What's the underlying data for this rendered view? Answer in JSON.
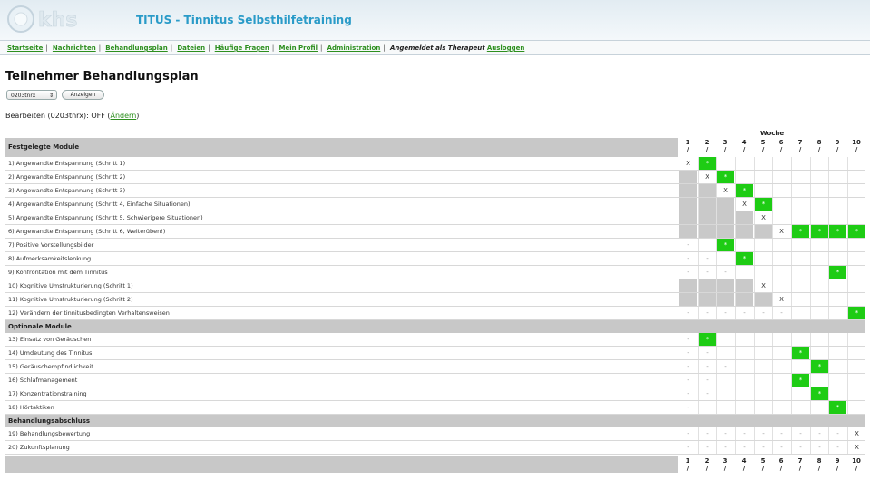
{
  "header": {
    "logo_text": "khs",
    "title": "TITUS - Tinnitus Selbsthilfetraining"
  },
  "nav": {
    "items": [
      "Startseite",
      "Nachrichten",
      "Behandlungsplan",
      "Dateien",
      "Häufige Fragen",
      "Mein Profil",
      "Administration"
    ],
    "logged_in": "Angemeldet als Therapeut",
    "logout": "Ausloggen"
  },
  "page": {
    "title": "Teilnehmer Behandlungsplan",
    "participant_select": "0203tnrx",
    "show_button": "Anzeigen",
    "edit_prefix": "Bearbeiten (0203tnrx): OFF (",
    "edit_link": "Ändern",
    "edit_suffix": ")"
  },
  "colors": {
    "active": "#1ecc14",
    "gray": "#c9c9c9",
    "link": "#2d8f1f",
    "title": "#2a9bc8"
  },
  "plan": {
    "woche_label": "Woche",
    "weeks": [
      "1",
      "2",
      "3",
      "4",
      "5",
      "6",
      "7",
      "8",
      "9",
      "10"
    ],
    "week_marker": "/",
    "sections": [
      {
        "title": "Festgelegte Module",
        "rows": [
          {
            "label": "1) Angewandte Entspannung (Schritt 1)",
            "cells": [
              "X",
              "A",
              "",
              "",
              "",
              "",
              "",
              "",
              "",
              ""
            ]
          },
          {
            "label": "2) Angewandte Entspannung (Schritt 2)",
            "cells": [
              "G",
              "X",
              "A",
              "",
              "",
              "",
              "",
              "",
              "",
              ""
            ]
          },
          {
            "label": "3) Angewandte Entspannung (Schritt 3)",
            "cells": [
              "G",
              "G",
              "X",
              "A",
              "",
              "",
              "",
              "",
              "",
              ""
            ]
          },
          {
            "label": "4) Angewandte Entspannung (Schritt 4, Einfache Situationen)",
            "cells": [
              "G",
              "G",
              "G",
              "X",
              "A",
              "",
              "",
              "",
              "",
              ""
            ]
          },
          {
            "label": "5) Angewandte Entspannung (Schritt 5, Schwierigere Situationen)",
            "cells": [
              "G",
              "G",
              "G",
              "G",
              "X",
              "",
              "",
              "",
              "",
              ""
            ]
          },
          {
            "label": "6) Angewandte Entspannung (Schritt 6, Weiterüben!)",
            "cells": [
              "G",
              "G",
              "G",
              "G",
              "G",
              "X",
              "A",
              "A",
              "A",
              "A"
            ]
          },
          {
            "label": "7) Positive Vorstellungsbilder",
            "cells": [
              "-",
              "",
              "A",
              "",
              "",
              "",
              "",
              "",
              "",
              ""
            ]
          },
          {
            "label": "8) Aufmerksamkeitslenkung",
            "cells": [
              "-",
              "-",
              "",
              "A",
              "",
              "",
              "",
              "",
              "",
              ""
            ]
          },
          {
            "label": "9) Konfrontation mit dem Tinnitus",
            "cells": [
              "-",
              "-",
              "-",
              "",
              "",
              "",
              "",
              "",
              "A",
              ""
            ]
          },
          {
            "label": "10) Kognitive Umstrukturierung (Schritt 1)",
            "cells": [
              "G",
              "G",
              "G",
              "G",
              "X",
              "",
              "",
              "",
              "",
              ""
            ]
          },
          {
            "label": "11) Kognitive Umstrukturierung (Schritt 2)",
            "cells": [
              "G",
              "G",
              "G",
              "G",
              "G",
              "X",
              "",
              "",
              "",
              ""
            ]
          },
          {
            "label": "12) Verändern der tinnitusbedingten Verhaltensweisen",
            "cells": [
              "-",
              "-",
              "-",
              "-",
              "-",
              "-",
              "",
              "",
              "",
              "A"
            ]
          }
        ]
      },
      {
        "title": "Optionale Module",
        "rows": [
          {
            "label": "13) Einsatz von Geräuschen",
            "cells": [
              "-",
              "A",
              "",
              "",
              "",
              "",
              "",
              "",
              "",
              ""
            ]
          },
          {
            "label": "14) Umdeutung des Tinnitus",
            "cells": [
              "-",
              "-",
              "",
              "",
              "",
              "",
              "A",
              "",
              "",
              ""
            ]
          },
          {
            "label": "15) Geräuschempfindlichkeit",
            "cells": [
              "-",
              "-",
              "-",
              "",
              "",
              "",
              "",
              "A",
              "",
              ""
            ]
          },
          {
            "label": "16) Schlafmanagement",
            "cells": [
              "-",
              "-",
              "",
              "",
              "",
              "",
              "A",
              "",
              "",
              ""
            ]
          },
          {
            "label": "17) Konzentrationstraining",
            "cells": [
              "-",
              "-",
              "",
              "",
              "",
              "",
              "",
              "A",
              "",
              ""
            ]
          },
          {
            "label": "18) Hörtaktiken",
            "cells": [
              "-",
              "",
              "",
              "",
              "",
              "",
              "",
              "",
              "A",
              ""
            ]
          }
        ]
      },
      {
        "title": "Behandlungsabschluss",
        "rows": [
          {
            "label": "19) Behandlungsbewertung",
            "cells": [
              "-",
              "-",
              "-",
              "-",
              "-",
              "-",
              "-",
              "-",
              "-",
              "X"
            ]
          },
          {
            "label": "20) Zukunftsplanung",
            "cells": [
              "-",
              "-",
              "-",
              "-",
              "-",
              "-",
              "-",
              "-",
              "-",
              "X"
            ]
          }
        ]
      }
    ]
  }
}
